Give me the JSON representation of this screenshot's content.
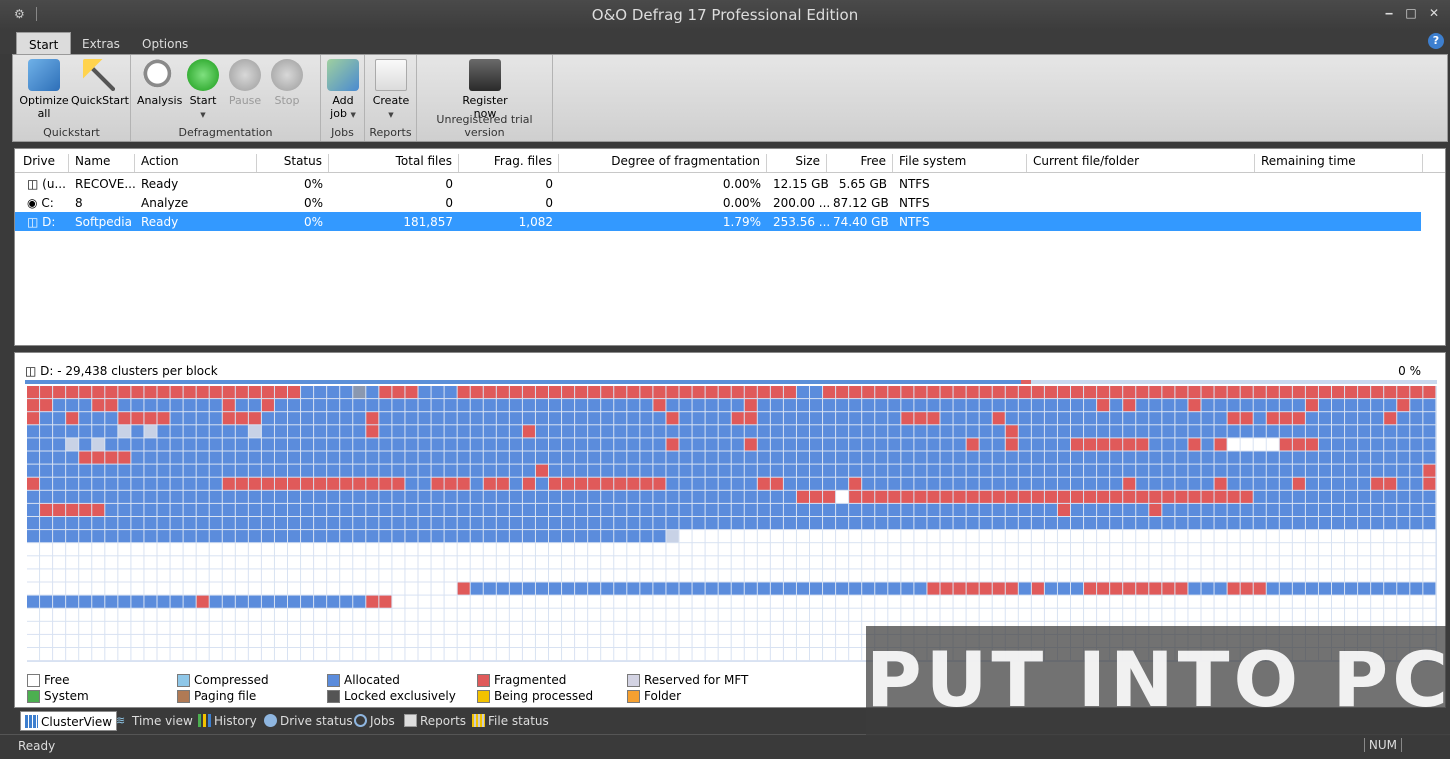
{
  "window": {
    "title": "O&O Defrag 17 Professional Edition"
  },
  "menu_tabs": [
    "Start",
    "Extras",
    "Options"
  ],
  "ribbon": {
    "groups": [
      {
        "label": "Quickstart",
        "buttons": [
          {
            "label": "Optimize all",
            "icon": "optimize-all-icon"
          },
          {
            "label": "QuickStart",
            "icon": "wand-icon"
          }
        ]
      },
      {
        "label": "Defragmentation",
        "buttons": [
          {
            "label": "Analysis",
            "icon": "magnifier-icon"
          },
          {
            "label": "Start",
            "icon": "play-icon"
          },
          {
            "label": "Pause",
            "icon": "pause-icon",
            "disabled": true
          },
          {
            "label": "Stop",
            "icon": "stop-icon",
            "disabled": true
          }
        ]
      },
      {
        "label": "Jobs",
        "buttons": [
          {
            "label": "Add job",
            "icon": "add-job-icon",
            "dropdown": true
          }
        ]
      },
      {
        "label": "Reports",
        "buttons": [
          {
            "label": "Create",
            "icon": "create-report-icon",
            "dropdown": true
          }
        ]
      },
      {
        "label": "Unregistered trial version",
        "buttons": [
          {
            "label": "Register now",
            "icon": "register-icon"
          }
        ]
      }
    ]
  },
  "drive_table": {
    "columns": [
      "Drive",
      "Name",
      "Action",
      "Status",
      "Total files",
      "Frag. files",
      "Degree of fragmentation",
      "Size",
      "Free",
      "File system",
      "Current file/folder",
      "Remaining time"
    ],
    "rows": [
      {
        "drive": "(u...",
        "name": "RECOVE...",
        "action": "Ready",
        "status": "0%",
        "total_files": "0",
        "frag_files": "0",
        "degree": "0.00%",
        "size": "12.15 GB",
        "free": "5.65 GB",
        "fs": "NTFS",
        "current": "",
        "remaining": ""
      },
      {
        "drive": "C:",
        "name": "8",
        "action": "Analyze",
        "status": "0%",
        "total_files": "0",
        "frag_files": "0",
        "degree": "0.00%",
        "size": "200.00 ...",
        "free": "87.12 GB",
        "fs": "NTFS",
        "current": "",
        "remaining": ""
      },
      {
        "drive": "D:",
        "name": "Softpedia",
        "action": "Ready",
        "status": "0%",
        "total_files": "181,857",
        "frag_files": "1,082",
        "degree": "1.79%",
        "size": "253.56 ...",
        "free": "74.40 GB",
        "fs": "NTFS",
        "current": "",
        "remaining": "",
        "selected": true
      }
    ]
  },
  "cluster_view": {
    "header": "D: - 29,438 clusters per block",
    "percent": "0 %",
    "colors": {
      "free": "#ffffff",
      "allocated": "#5b8cdc",
      "fragmented": "#e05a5a",
      "reserved": "#c8d2e6",
      "locked": "#8a98b0"
    }
  },
  "legend": [
    {
      "label": "Free",
      "color": "#ffffff"
    },
    {
      "label": "System",
      "color": "#4caf50"
    },
    {
      "label": "Compressed",
      "color": "#8fc7e8"
    },
    {
      "label": "Paging file",
      "color": "#b07a55"
    },
    {
      "label": "Allocated",
      "color": "#5b8cdc"
    },
    {
      "label": "Locked exclusively",
      "color": "#555555"
    },
    {
      "label": "Fragmented",
      "color": "#e05a5a"
    },
    {
      "label": "Being processed",
      "color": "#f2c200"
    },
    {
      "label": "Reserved for MFT",
      "color": "#d3d3e3"
    },
    {
      "label": "Folder",
      "color": "#f5a030"
    }
  ],
  "view_tabs": [
    "ClusterView",
    "Time view",
    "History",
    "Drive status",
    "Jobs",
    "Reports",
    "File status"
  ],
  "status": {
    "text": "Ready",
    "num": "NUM"
  },
  "watermark": "PUT INTO PC"
}
